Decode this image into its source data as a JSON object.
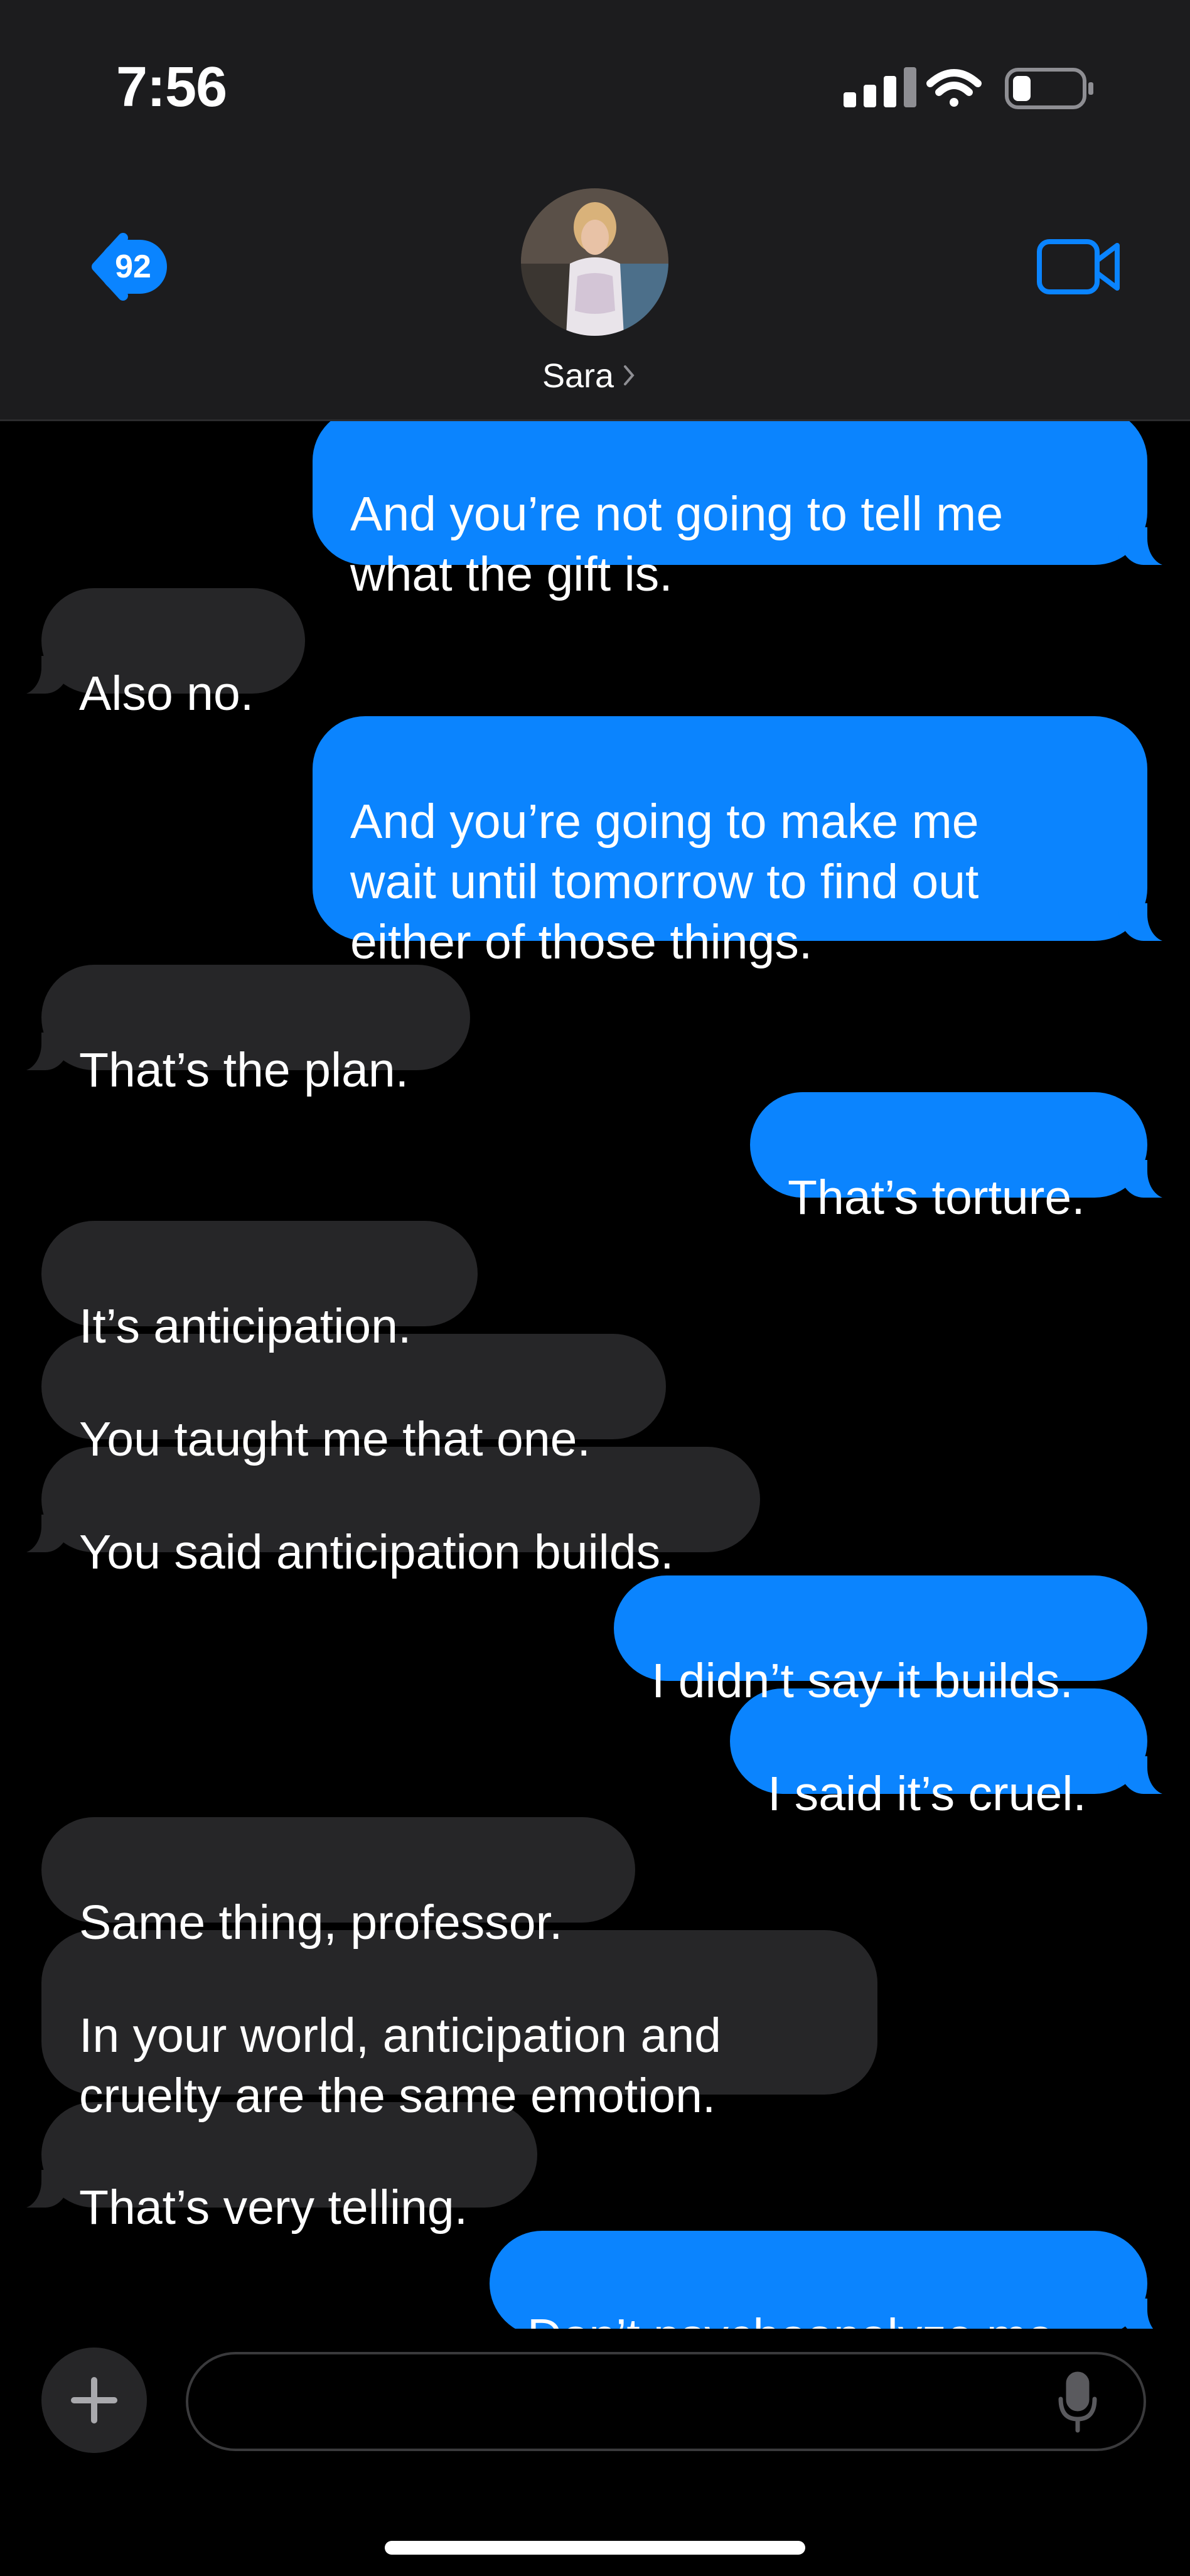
{
  "status_bar": {
    "time": "7:56"
  },
  "header": {
    "unread_count": "92",
    "contact_name": "Sara"
  },
  "messages": [
    {
      "sender": "me",
      "text": "And you’re not going to tell me\nwhat the gift is."
    },
    {
      "sender": "them",
      "text": "Also no."
    },
    {
      "sender": "me",
      "text": "And you’re going to make me\nwait until tomorrow to find out\neither of those things."
    },
    {
      "sender": "them",
      "text": "That’s the plan."
    },
    {
      "sender": "me",
      "text": "That’s torture."
    },
    {
      "sender": "them",
      "text": "It’s anticipation."
    },
    {
      "sender": "them",
      "text": "You taught me that one."
    },
    {
      "sender": "them",
      "text": "You said anticipation builds."
    },
    {
      "sender": "me",
      "text": "I didn’t say it builds."
    },
    {
      "sender": "me",
      "text": "I said it’s cruel."
    },
    {
      "sender": "them",
      "text": "Same thing, professor."
    },
    {
      "sender": "them",
      "text": "In your world, anticipation and\ncruelty are the same emotion."
    },
    {
      "sender": "them",
      "text": "That’s very telling."
    },
    {
      "sender": "me",
      "text": "Don’t psychoanalyze me."
    }
  ],
  "composer": {
    "placeholder": ""
  },
  "icons": {
    "back": "chevron-left-icon",
    "video": "video-camera-icon",
    "plus": "plus-icon",
    "mic": "microphone-icon",
    "signal": "cellular-signal-icon",
    "wifi": "wifi-icon",
    "battery": "battery-icon"
  },
  "colors": {
    "outgoing_bubble": "#0b84fe",
    "incoming_bubble": "#262628",
    "background": "#000000",
    "header": "#1c1c1e"
  }
}
